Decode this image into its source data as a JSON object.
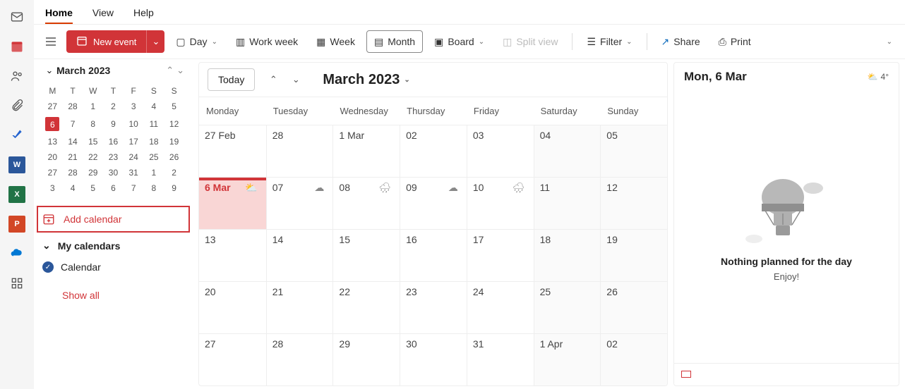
{
  "tabs": {
    "home": "Home",
    "view": "View",
    "help": "Help"
  },
  "toolbar": {
    "new": "New event",
    "day": "Day",
    "workweek": "Work week",
    "week": "Week",
    "month": "Month",
    "board": "Board",
    "split": "Split view",
    "filter": "Filter",
    "share": "Share",
    "print": "Print"
  },
  "mini": {
    "title": "March 2023",
    "dow": [
      "M",
      "T",
      "W",
      "T",
      "F",
      "S",
      "S"
    ],
    "rows": [
      [
        "27",
        "28",
        "1",
        "2",
        "3",
        "4",
        "5"
      ],
      [
        "6",
        "7",
        "8",
        "9",
        "10",
        "11",
        "12"
      ],
      [
        "13",
        "14",
        "15",
        "16",
        "17",
        "18",
        "19"
      ],
      [
        "20",
        "21",
        "22",
        "23",
        "24",
        "25",
        "26"
      ],
      [
        "27",
        "28",
        "29",
        "30",
        "31",
        "1",
        "2"
      ],
      [
        "3",
        "4",
        "5",
        "6",
        "7",
        "8",
        "9"
      ]
    ],
    "today": "6"
  },
  "side": {
    "add": "Add calendar",
    "mycal": "My calendars",
    "cal1": "Calendar",
    "showall": "Show all"
  },
  "calendar": {
    "today": "Today",
    "title": "March 2023",
    "dow": [
      "Monday",
      "Tuesday",
      "Wednesday",
      "Thursday",
      "Friday",
      "Saturday",
      "Sunday"
    ],
    "cells": [
      {
        "l": "27 Feb"
      },
      {
        "l": "28"
      },
      {
        "l": "1 Mar"
      },
      {
        "l": "02"
      },
      {
        "l": "03"
      },
      {
        "l": "04",
        "we": true
      },
      {
        "l": "05",
        "we": true
      },
      {
        "l": "6 Mar",
        "today": true,
        "wx": "⛅"
      },
      {
        "l": "07",
        "wx": "☁"
      },
      {
        "l": "08",
        "wx": "🌧"
      },
      {
        "l": "09",
        "wx": "☁"
      },
      {
        "l": "10",
        "wx": "🌧"
      },
      {
        "l": "11",
        "we": true
      },
      {
        "l": "12",
        "we": true
      },
      {
        "l": "13"
      },
      {
        "l": "14"
      },
      {
        "l": "15"
      },
      {
        "l": "16"
      },
      {
        "l": "17"
      },
      {
        "l": "18",
        "we": true
      },
      {
        "l": "19",
        "we": true
      },
      {
        "l": "20"
      },
      {
        "l": "21"
      },
      {
        "l": "22"
      },
      {
        "l": "23"
      },
      {
        "l": "24"
      },
      {
        "l": "25",
        "we": true
      },
      {
        "l": "26",
        "we": true
      },
      {
        "l": "27"
      },
      {
        "l": "28"
      },
      {
        "l": "29"
      },
      {
        "l": "30"
      },
      {
        "l": "31"
      },
      {
        "l": "1 Apr",
        "we": true
      },
      {
        "l": "02",
        "we": true
      }
    ]
  },
  "agenda": {
    "date": "Mon, 6 Mar",
    "temp": "4°",
    "msg1": "Nothing planned for the day",
    "msg2": "Enjoy!"
  },
  "rail": {
    "apps": [
      {
        "name": "word-app",
        "bg": "#2b579a",
        "label": "W"
      },
      {
        "name": "excel-app",
        "bg": "#217346",
        "label": "X"
      },
      {
        "name": "powerpoint-app",
        "bg": "#d24726",
        "label": "P"
      },
      {
        "name": "onedrive-app",
        "bg": "#0078d4",
        "label": ""
      }
    ]
  }
}
